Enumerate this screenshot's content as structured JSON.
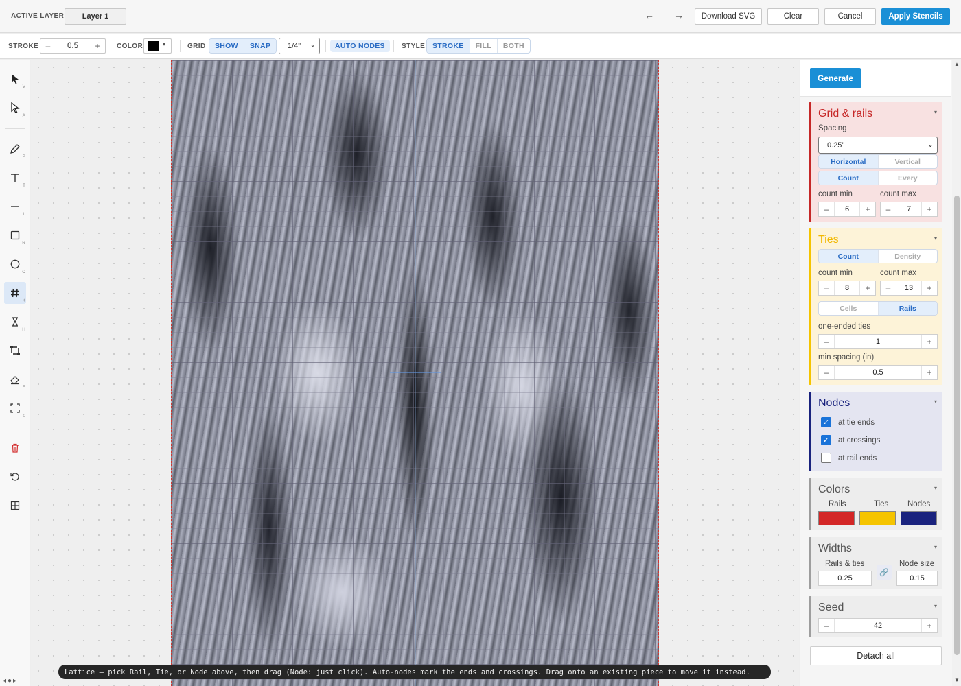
{
  "topbar": {
    "active_layer_label": "ACTIVE LAYER",
    "layer_name": "Layer 1",
    "undo_icon": "arrow-left-icon",
    "redo_icon": "arrow-right-icon",
    "download_svg": "Download SVG",
    "clear": "Clear",
    "cancel": "Cancel",
    "apply_stencils": "Apply Stencils"
  },
  "toolbar": {
    "stroke_label": "STROKE",
    "stroke_value": "0.5",
    "stroke_minus": "–",
    "stroke_plus": "+",
    "color_label": "COLOR",
    "color_value": "#000000",
    "grid_label": "GRID",
    "grid_show": "SHOW",
    "grid_snap": "SNAP",
    "grid_size": "1/4\"",
    "auto_nodes": "AUTO NODES",
    "style_label": "STYLE",
    "style_options": [
      "STROKE",
      "FILL",
      "BOTH"
    ]
  },
  "tools": [
    {
      "name": "select",
      "key": "V",
      "icon": "arrow-pointer-icon"
    },
    {
      "name": "direct-select",
      "key": "A",
      "icon": "hollow-pointer-icon"
    },
    {
      "name": "pen",
      "key": "P",
      "icon": "pen-icon"
    },
    {
      "name": "text",
      "key": "T",
      "icon": "text-icon"
    },
    {
      "name": "line",
      "key": "L",
      "icon": "line-icon"
    },
    {
      "name": "rectangle",
      "key": "R",
      "icon": "square-icon"
    },
    {
      "name": "ellipse",
      "key": "C",
      "icon": "circle-icon"
    },
    {
      "name": "lattice",
      "key": "K",
      "icon": "hash-icon"
    },
    {
      "name": "hourglass",
      "key": "H",
      "icon": "hourglass-icon"
    },
    {
      "name": "node-frame",
      "key": "",
      "icon": "node-frame-icon"
    },
    {
      "name": "eraser",
      "key": "E",
      "icon": "eraser-icon"
    },
    {
      "name": "fit",
      "key": "0",
      "icon": "fit-frame-icon"
    },
    {
      "name": "delete",
      "key": "",
      "icon": "trash-icon"
    },
    {
      "name": "reset",
      "key": "",
      "icon": "rotate-icon"
    },
    {
      "name": "tiles",
      "key": "",
      "icon": "grid-icon"
    }
  ],
  "status_text": "Lattice — pick Rail, Tie, or Node above, then drag (Node: just click). Auto-nodes mark the ends and crossings. Drag onto an existing piece to move it instead.",
  "panel": {
    "generate": "Generate",
    "grid_rails": {
      "title": "Grid & rails",
      "accent": "#c62828",
      "spacing_label": "Spacing",
      "spacing_value": "0.25\"",
      "orientation": [
        "Horizontal",
        "Vertical"
      ],
      "mode": [
        "Count",
        "Every"
      ],
      "count_min_label": "count min",
      "count_min": "6",
      "count_max_label": "count max",
      "count_max": "7"
    },
    "ties": {
      "title": "Ties",
      "accent": "#f5c400",
      "mode": [
        "Count",
        "Density"
      ],
      "count_min_label": "count min",
      "count_min": "8",
      "count_max_label": "count max",
      "count_max": "13",
      "placement": [
        "Cells",
        "Rails"
      ],
      "one_ended_label": "one-ended ties",
      "one_ended": "1",
      "min_spacing_label": "min spacing (in)",
      "min_spacing": "0.5"
    },
    "nodes": {
      "title": "Nodes",
      "accent": "#1a237e",
      "options": [
        {
          "label": "at tie ends",
          "checked": true
        },
        {
          "label": "at crossings",
          "checked": true
        },
        {
          "label": "at rail ends",
          "checked": false
        }
      ]
    },
    "colors": {
      "title": "Colors",
      "labels": [
        "Rails",
        "Ties",
        "Nodes"
      ],
      "values": [
        "#d32626",
        "#f5c400",
        "#1a237e"
      ]
    },
    "widths": {
      "title": "Widths",
      "rails_ties_label": "Rails & ties",
      "rails_ties": "0.25",
      "node_size_label": "Node size",
      "node_size": "0.15",
      "link_icon": "link-icon"
    },
    "seed": {
      "title": "Seed",
      "value": "42"
    },
    "detach_all": "Detach all"
  }
}
